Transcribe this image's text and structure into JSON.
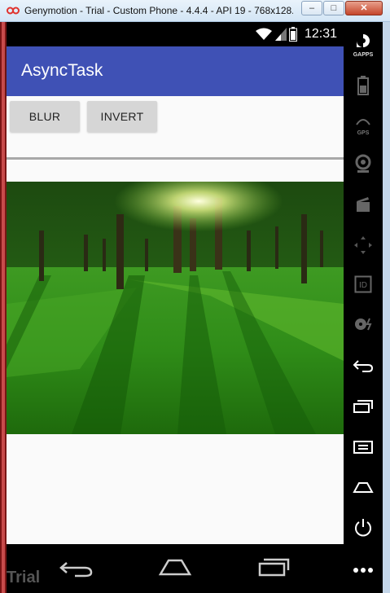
{
  "window": {
    "title": "Genymotion - Trial - Custom Phone - 4.4.4 - API 19 - 768x128...",
    "minimize_label": "–",
    "maximize_label": "□",
    "close_label": "✕"
  },
  "statusbar": {
    "time": "12:31",
    "icons": [
      "wifi-icon",
      "signal-icon",
      "battery-icon"
    ]
  },
  "app": {
    "title": "AsyncTask"
  },
  "buttons": {
    "blur": "BLUR",
    "invert": "INVERT"
  },
  "sidepanel": {
    "gapps_label": "GAPPS",
    "gps_label": "GPS",
    "items": [
      "gapps-icon",
      "battery-icon",
      "gps-icon",
      "webcam-icon",
      "clapper-icon",
      "dpad-icon",
      "id-icon",
      "disc-icon",
      "back-icon",
      "recents-icon",
      "menu-icon",
      "home-icon",
      "power-icon",
      "more-icon"
    ]
  },
  "navbar": {
    "items": [
      "back-icon",
      "home-icon",
      "recents-icon"
    ]
  },
  "watermark": "Trial",
  "colors": {
    "actionbar": "#3f51b5",
    "button": "#d6d6d6",
    "close": "#c5462b"
  }
}
